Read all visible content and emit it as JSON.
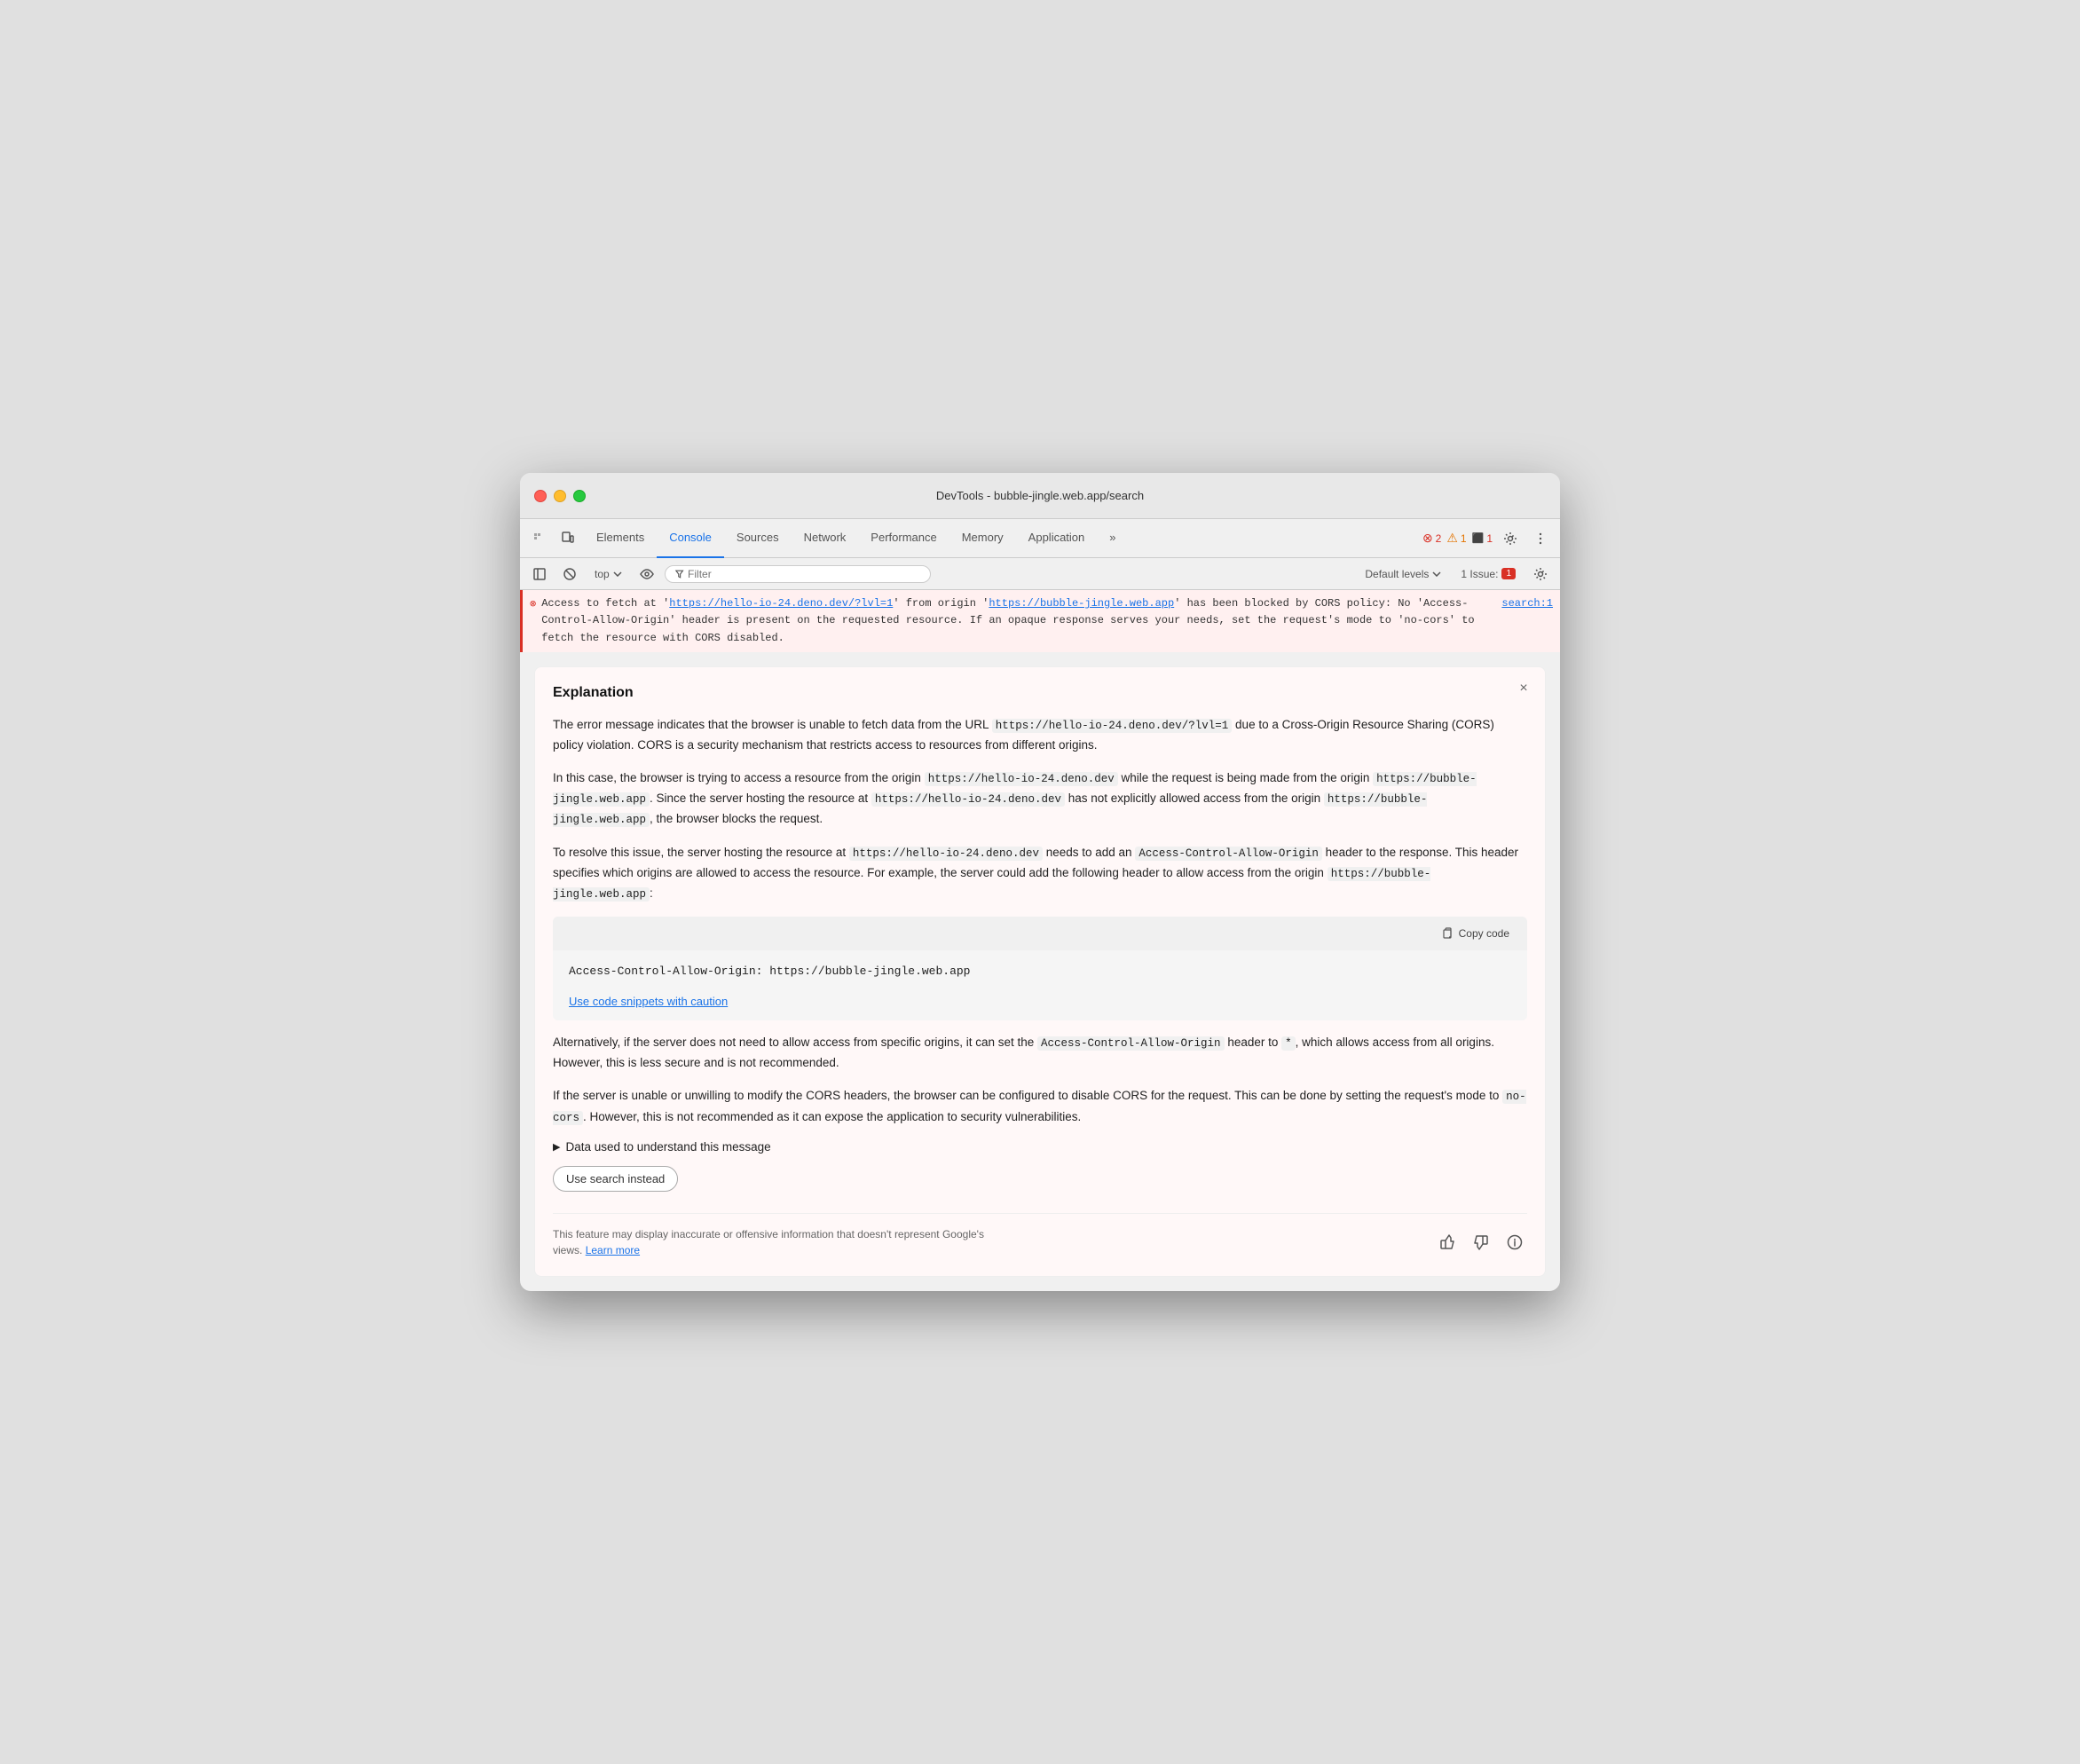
{
  "window": {
    "title": "DevTools - bubble-jingle.web.app/search"
  },
  "tabs": [
    {
      "label": "Elements",
      "active": false
    },
    {
      "label": "Console",
      "active": true
    },
    {
      "label": "Sources",
      "active": false
    },
    {
      "label": "Network",
      "active": false
    },
    {
      "label": "Performance",
      "active": false
    },
    {
      "label": "Memory",
      "active": false
    },
    {
      "label": "Application",
      "active": false
    },
    {
      "label": "»",
      "active": false
    }
  ],
  "toolbar": {
    "top_label": "top",
    "filter_placeholder": "Filter",
    "default_levels": "Default levels",
    "issue_label": "1 Issue:",
    "error_count": "2",
    "warning_count": "1",
    "issue_count": "1"
  },
  "console_error": {
    "url1": "https://hello-io-24.deno.dev/?lvl=1",
    "url2": "https://bubble-jingle.web.app",
    "source": "search:1",
    "message": "Access to fetch at 'https://hello-io-24.deno.dev/?lvl=1' from origin 'https://bubble-jingle.web.app' has been blocked by CORS policy: No 'Access-Control-Allow-Origin' header is present on the requested resource. If an opaque response serves your needs, set the request's mode to 'no-cors' to fetch the resource with CORS disabled."
  },
  "explanation": {
    "title": "Explanation",
    "close_label": "×",
    "para1": "The error message indicates that the browser is unable to fetch data from the URL https://hello-io-24.deno.dev/?lvl=1 due to a Cross-Origin Resource Sharing (CORS) policy violation. CORS is a security mechanism that restricts access to resources from different origins.",
    "para2_start": "In this case, the browser is trying to access a resource from the origin ",
    "para2_code1": "https://hello-io-24.deno.dev",
    "para2_mid": " while the request is being made from the origin ",
    "para2_code2": "https://bubble-jingle.web.app",
    "para2_mid2": ". Since the server hosting the resource at ",
    "para2_code3": "https://hello-io-24.deno.dev",
    "para2_end": " has not explicitly allowed access from the origin ",
    "para2_code4": "https://bubble-jingle.web.app",
    "para2_final": ", the browser blocks the request.",
    "para3_start": "To resolve this issue, the server hosting the resource at ",
    "para3_code1": "https://hello-io-24.deno.dev",
    "para3_mid": " needs to add an ",
    "para3_code2": "Access-Control-Allow-Origin",
    "para3_mid2": " header to the response. This header specifies which origins are allowed to access the resource. For example, the server could add the following header to allow access from the origin ",
    "para3_code3": "https://bubble-jingle.web.app",
    "para3_end": ":",
    "copy_code_label": "Copy code",
    "code_snippet": "Access-Control-Allow-Origin: https://bubble-jingle.web.app",
    "caution_link": "Use code snippets with caution",
    "para4_start": "Alternatively, if the server does not need to allow access from specific origins, it can set the ",
    "para4_code1": "Access-Control-Allow-Origin",
    "para4_mid": " header to ",
    "para4_code2": "*",
    "para4_end": ", which allows access from all origins. However, this is less secure and is not recommended.",
    "para5_start": "If the server is unable or unwilling to modify the CORS headers, the browser can be configured to disable CORS for the request. This can be done by setting the request's mode to ",
    "para5_code1": "no-cors",
    "para5_end": ". However, this is not recommended as it can expose the application to security vulnerabilities.",
    "data_disclosure": "Data used to understand this message",
    "use_search_label": "Use search instead",
    "footer_text": "This feature may display inaccurate or offensive information that doesn't represent Google's views.",
    "learn_more": "Learn more"
  }
}
